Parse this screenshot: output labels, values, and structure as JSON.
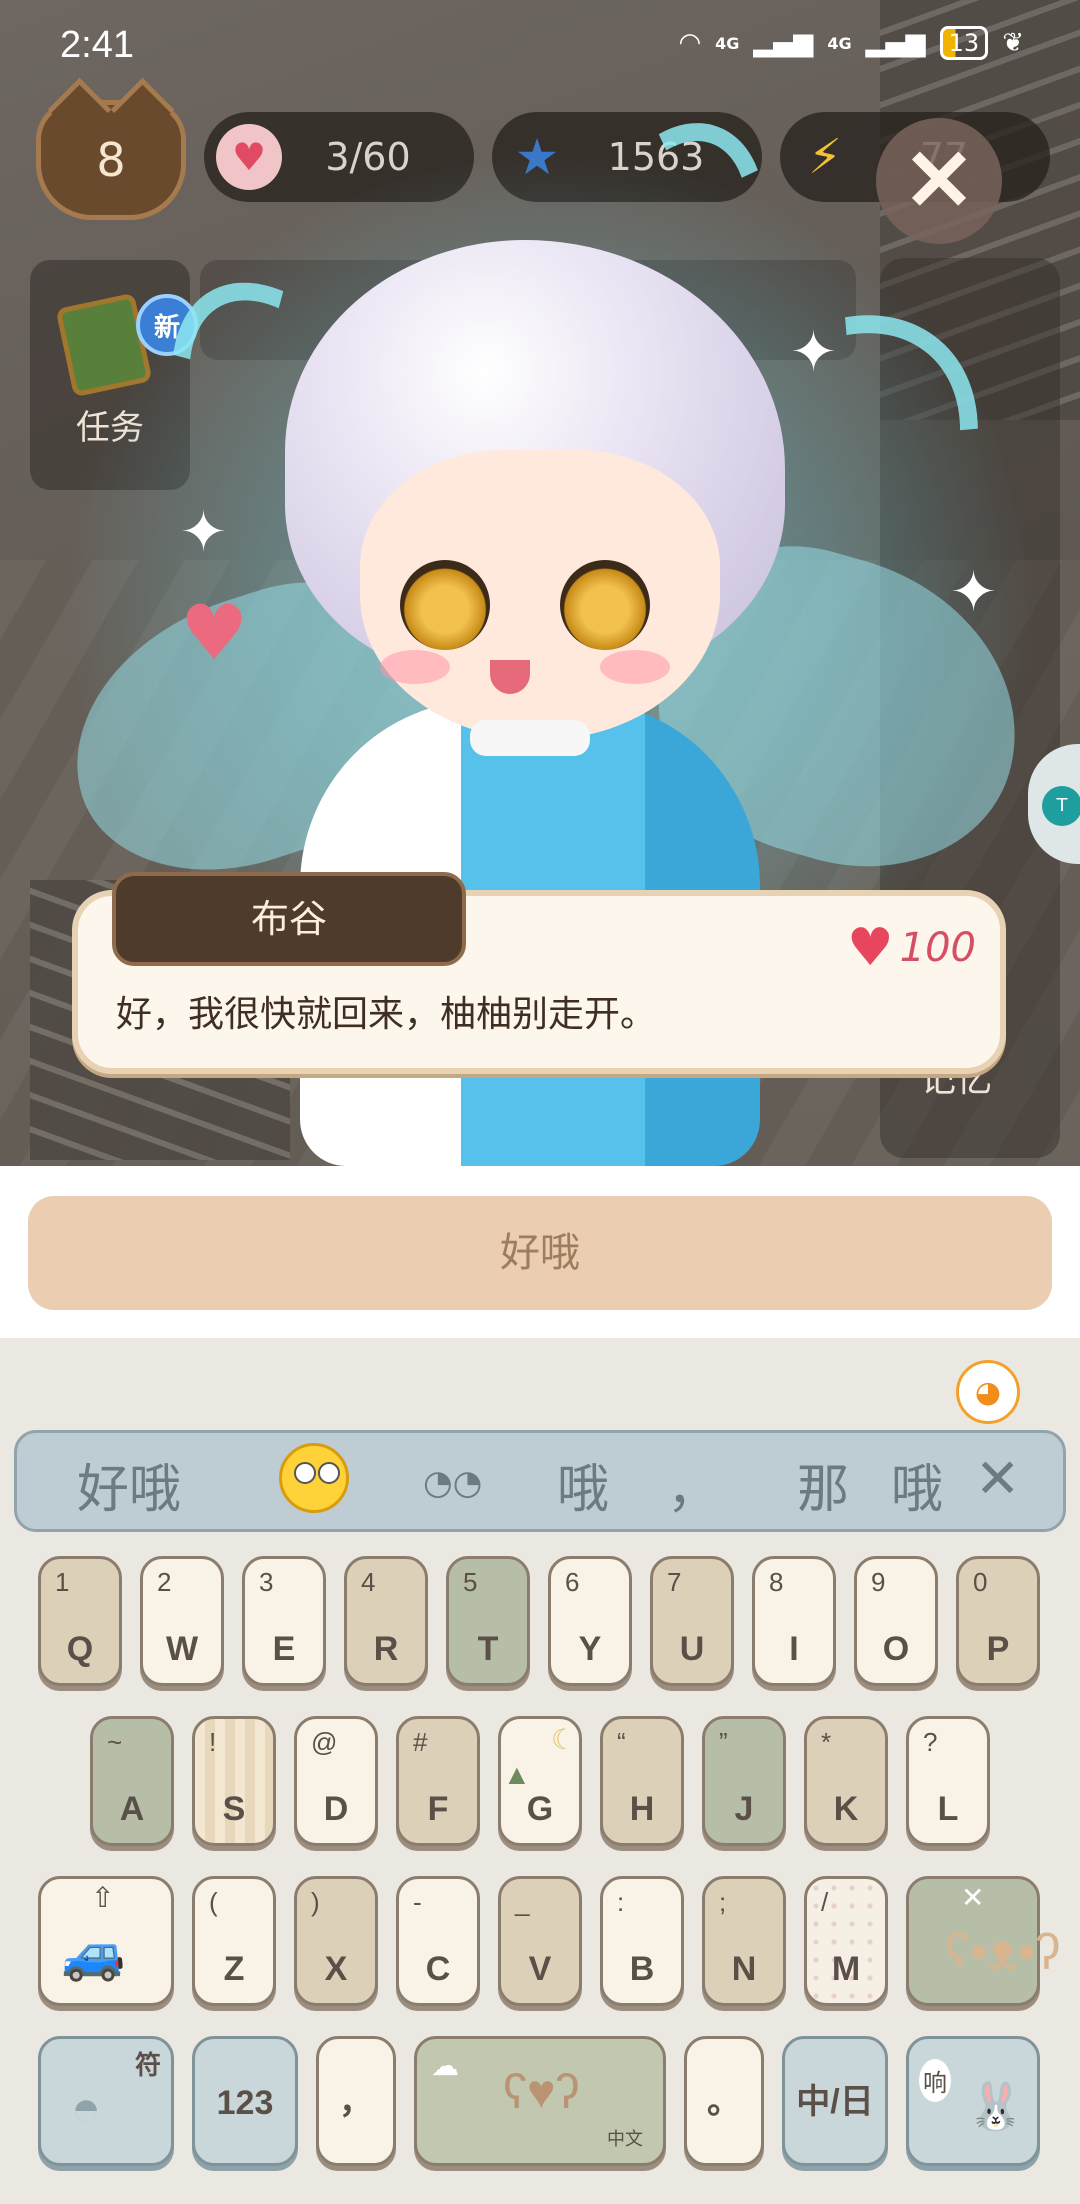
{
  "status_bar": {
    "time": "2:41",
    "network_1": "4G",
    "network_2": "4G",
    "battery": "13"
  },
  "hud": {
    "level": "8",
    "hearts": "3/60",
    "stars": "1563",
    "energy": "77",
    "task_badge": "新",
    "task_label": "任务",
    "memory_label": "记忆"
  },
  "dialog": {
    "speaker": "布谷",
    "affinity": "100",
    "text": "好，我很快就回来，柚柚别走开。"
  },
  "reply": {
    "option": "好哦"
  },
  "keyboard": {
    "suggestions": [
      "好哦",
      "◔◔",
      "哦",
      "，",
      "那",
      "哦"
    ],
    "row1": [
      {
        "main": "Q",
        "sub": "1"
      },
      {
        "main": "W",
        "sub": "2"
      },
      {
        "main": "E",
        "sub": "3"
      },
      {
        "main": "R",
        "sub": "4"
      },
      {
        "main": "T",
        "sub": "5"
      },
      {
        "main": "Y",
        "sub": "6"
      },
      {
        "main": "U",
        "sub": "7"
      },
      {
        "main": "I",
        "sub": "8"
      },
      {
        "main": "O",
        "sub": "9"
      },
      {
        "main": "P",
        "sub": "0"
      }
    ],
    "row2": [
      {
        "main": "A",
        "sub": "~"
      },
      {
        "main": "S",
        "sub": "!"
      },
      {
        "main": "D",
        "sub": "@"
      },
      {
        "main": "F",
        "sub": "#"
      },
      {
        "main": "G",
        "sub": ""
      },
      {
        "main": "H",
        "sub": "“"
      },
      {
        "main": "J",
        "sub": "”"
      },
      {
        "main": "K",
        "sub": "*"
      },
      {
        "main": "L",
        "sub": "?"
      }
    ],
    "row3": [
      {
        "main": "Z",
        "sub": "("
      },
      {
        "main": "X",
        "sub": ")"
      },
      {
        "main": "C",
        "sub": "-"
      },
      {
        "main": "V",
        "sub": "_"
      },
      {
        "main": "B",
        "sub": ":"
      },
      {
        "main": "N",
        "sub": ";"
      },
      {
        "main": "M",
        "sub": "/"
      }
    ],
    "symbols_label": "符",
    "numbers_label": "123",
    "comma": "，",
    "period": "。",
    "ime_label": "中/日",
    "voice_label": "响",
    "space_deco": "中文"
  },
  "icons": {
    "heart": "heart-icon",
    "star": "star-icon",
    "energy": "lightning-icon",
    "close": "close-icon"
  },
  "colors": {
    "reply_button": "#ebcdb1",
    "speaker_tag": "#4f3b2c",
    "affinity": "#d64e63"
  }
}
